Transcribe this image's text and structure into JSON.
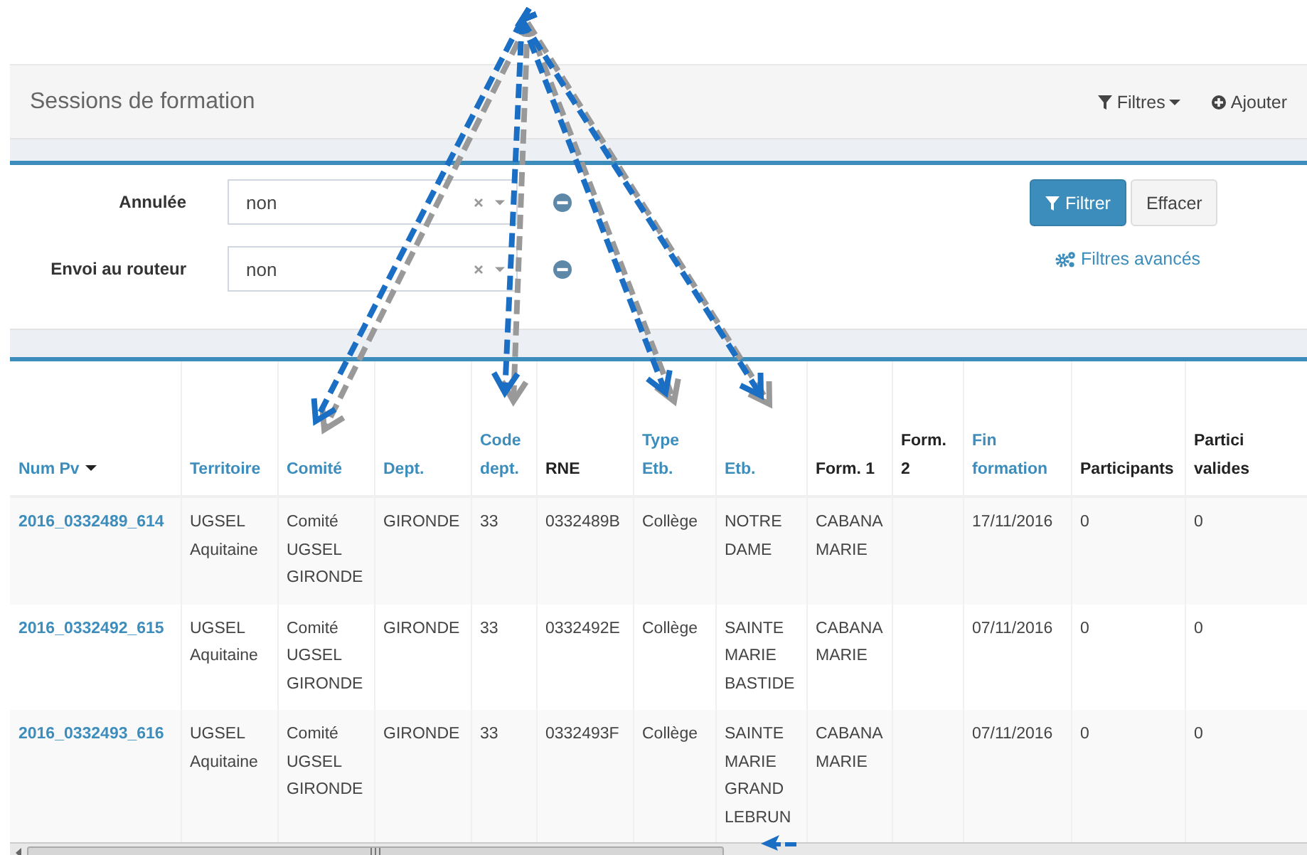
{
  "header": {
    "title": "Sessions de formation",
    "actions": [
      {
        "label": "Filtres",
        "kind": "filter",
        "dropdown": true
      },
      {
        "label": "Ajouter",
        "kind": "plus",
        "dropdown": false
      }
    ]
  },
  "filters": [
    {
      "label": "Annulée",
      "value": "non"
    },
    {
      "label": "Envoi au routeur",
      "value": "non"
    }
  ],
  "filter_buttons": [
    {
      "label": "Filtrer",
      "kind": "primary"
    },
    {
      "label": "Effacer",
      "kind": "default"
    }
  ],
  "advanced_link": "Filtres avancés",
  "table": {
    "columns": [
      {
        "label": "Num Pv",
        "sortable": true,
        "sorted": true
      },
      {
        "label": "Territoire",
        "sortable": true,
        "sorted": false
      },
      {
        "label": "Comité",
        "sortable": true,
        "sorted": false
      },
      {
        "label": "Dept.",
        "sortable": true,
        "sorted": false
      },
      {
        "label": "Code dept.",
        "sortable": true,
        "sorted": false
      },
      {
        "label": "RNE",
        "sortable": false,
        "sorted": false
      },
      {
        "label": "Type Etb.",
        "sortable": true,
        "sorted": false
      },
      {
        "label": "Etb.",
        "sortable": true,
        "sorted": false
      },
      {
        "label": "Form. 1",
        "sortable": false,
        "sorted": false
      },
      {
        "label": "Form. 2",
        "sortable": false,
        "sorted": false
      },
      {
        "label": "Fin formation",
        "sortable": true,
        "sorted": false
      },
      {
        "label": "Participants",
        "sortable": false,
        "sorted": false
      },
      {
        "label": "Partici valides",
        "sortable": false,
        "sorted": false
      }
    ],
    "rows": [
      [
        "2016_0332489_614",
        "UGSEL Aquitaine",
        "Comité UGSEL GIRONDE",
        "GIRONDE",
        "33",
        "0332489B",
        "Collège",
        "NOTRE DAME",
        "CABANA MARIE",
        null,
        "17/11/2016",
        "0",
        "0"
      ],
      [
        "2016_0332492_615",
        "UGSEL Aquitaine",
        "Comité UGSEL GIRONDE",
        "GIRONDE",
        "33",
        "0332492E",
        "Collège",
        "SAINTE MARIE BASTIDE",
        "CABANA MARIE",
        null,
        "07/11/2016",
        "0",
        "0"
      ],
      [
        "2016_0332493_616",
        "UGSEL Aquitaine",
        "Comité UGSEL GIRONDE",
        "GIRONDE",
        "33",
        "0332493F",
        "Collège",
        "SAINTE MARIE GRAND LEBRUN",
        "CABANA MARIE",
        null,
        "07/11/2016",
        "0",
        "0"
      ]
    ]
  }
}
